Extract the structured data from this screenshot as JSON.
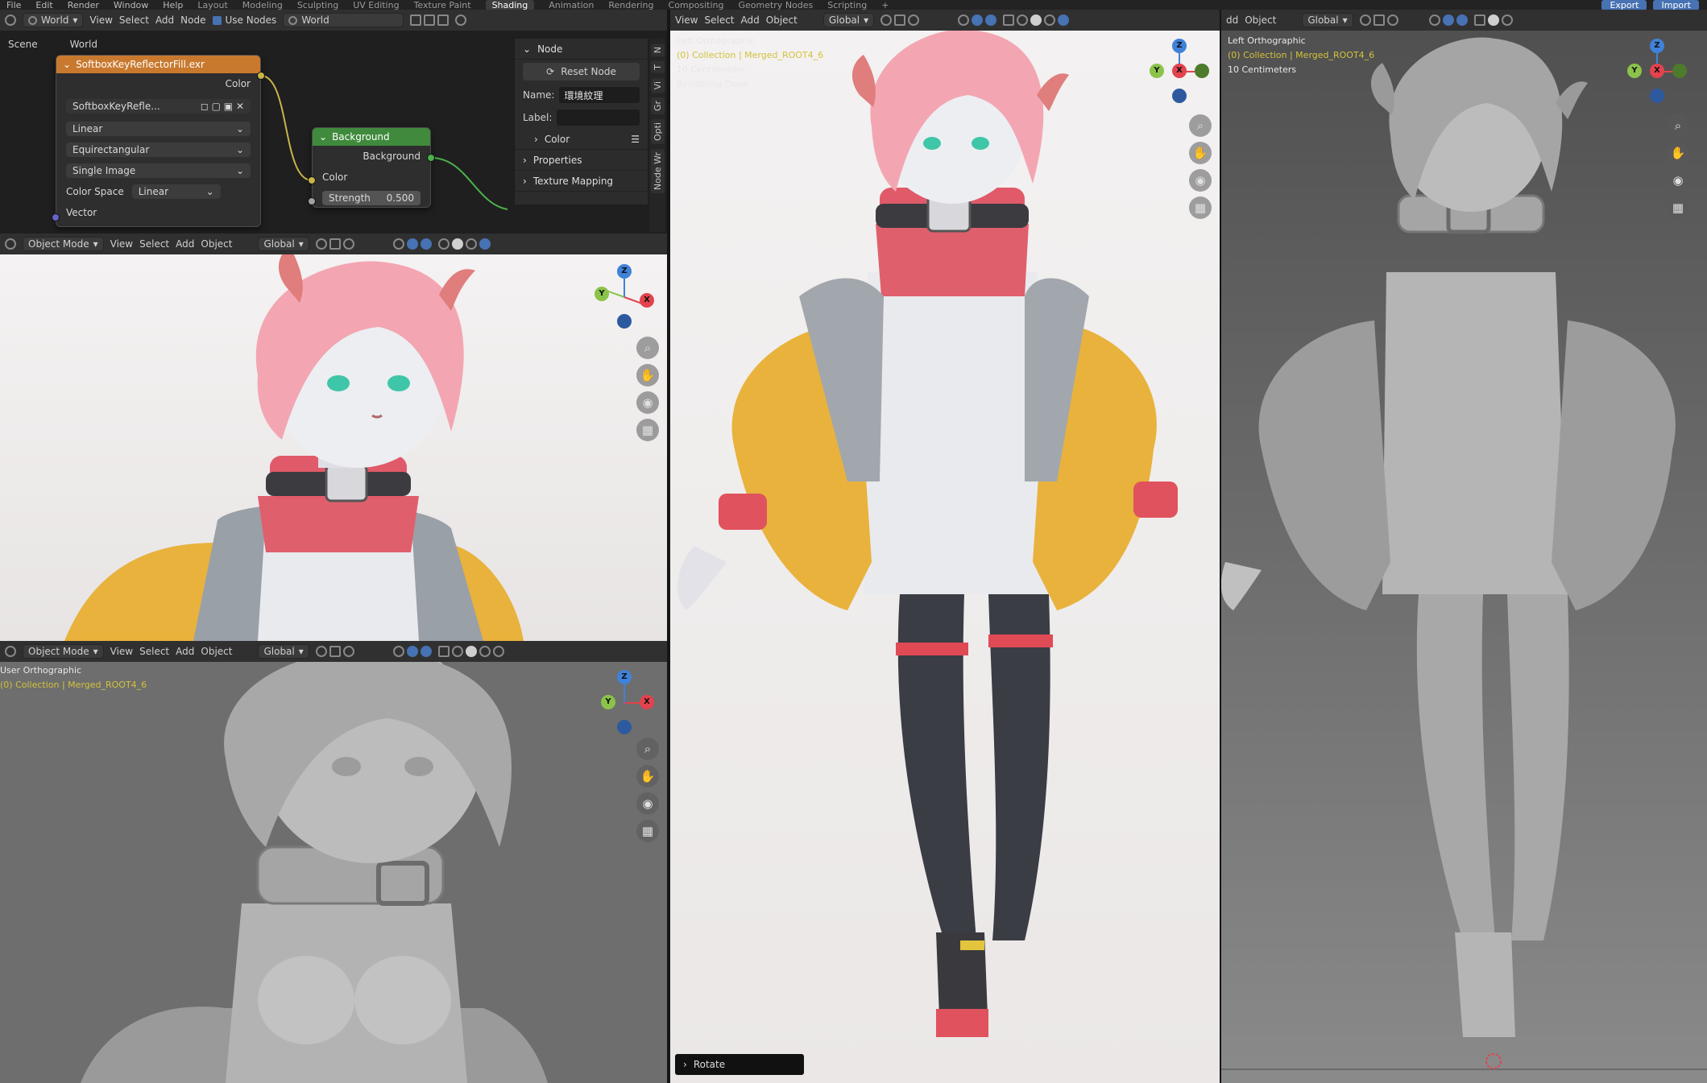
{
  "menubar": {
    "menus": [
      "File",
      "Edit",
      "Render",
      "Window",
      "Help"
    ],
    "workspaces": [
      "Layout",
      "Modeling",
      "Sculpting",
      "UV Editing",
      "Texture Paint",
      "Shading",
      "Animation",
      "Rendering",
      "Compositing",
      "Geometry Nodes",
      "Scripting",
      "+"
    ],
    "active_workspace": "Shading",
    "right": [
      "Export",
      "Import"
    ]
  },
  "node_editor": {
    "header": {
      "world_dd": "World",
      "menus": [
        "View",
        "Select",
        "Add",
        "Node"
      ],
      "use_nodes": "Use Nodes",
      "world_field": "World"
    },
    "breadcrumb": [
      "Scene",
      "World"
    ],
    "image_node": {
      "title": "SoftboxKeyReflectorFill.exr",
      "output": "Color",
      "image_name": "SoftboxKeyRefle...",
      "interpolation": "Linear",
      "projection": "Equirectangular",
      "source": "Single Image",
      "color_space_label": "Color Space",
      "color_space": "Linear",
      "input": "Vector"
    },
    "background_node": {
      "title": "Background",
      "output": "Background",
      "color": "Color",
      "strength_label": "Strength",
      "strength": "0.500"
    },
    "sidebar": {
      "section": "Node",
      "reset": "Reset Node",
      "name_label": "Name:",
      "name_value": "環境紋理",
      "label_label": "Label:",
      "label_value": "",
      "color": "Color",
      "properties": "Properties",
      "texture_mapping": "Texture Mapping",
      "tabs": [
        "N",
        "T",
        "Vi",
        "Gr",
        "Opti",
        "Node Wr"
      ]
    }
  },
  "viewport_header": {
    "mode": "Object Mode",
    "menus": [
      "View",
      "Select",
      "Add",
      "Object"
    ],
    "orientation": "Global"
  },
  "viewport_top_left": {},
  "viewport_bottom_left": {
    "view": "User Orthographic",
    "collection": "(0) Collection | Merged_ROOT4_6"
  },
  "viewport_center": {
    "view": "Left Orthographic",
    "collection": "(0) Collection | Merged_ROOT4_6",
    "scale": "10 Centimeters",
    "status": "Rendering Done",
    "operator": "Rotate"
  },
  "viewport_right": {
    "header_partial": "dd",
    "header_menu": "Object",
    "view": "Left Orthographic",
    "collection": "(0) Collection | Merged_ROOT4_6",
    "scale": "10 Centimeters"
  },
  "gizmo": {
    "x": "X",
    "y": "Y",
    "z": "Z"
  },
  "colors": {
    "x_axis": "#e2434e",
    "y_axis": "#8bc34a",
    "z_axis": "#3f82d9",
    "image_node_header": "#c9792e",
    "background_node_header": "#3f8a3c",
    "accent": "#4772b3"
  }
}
